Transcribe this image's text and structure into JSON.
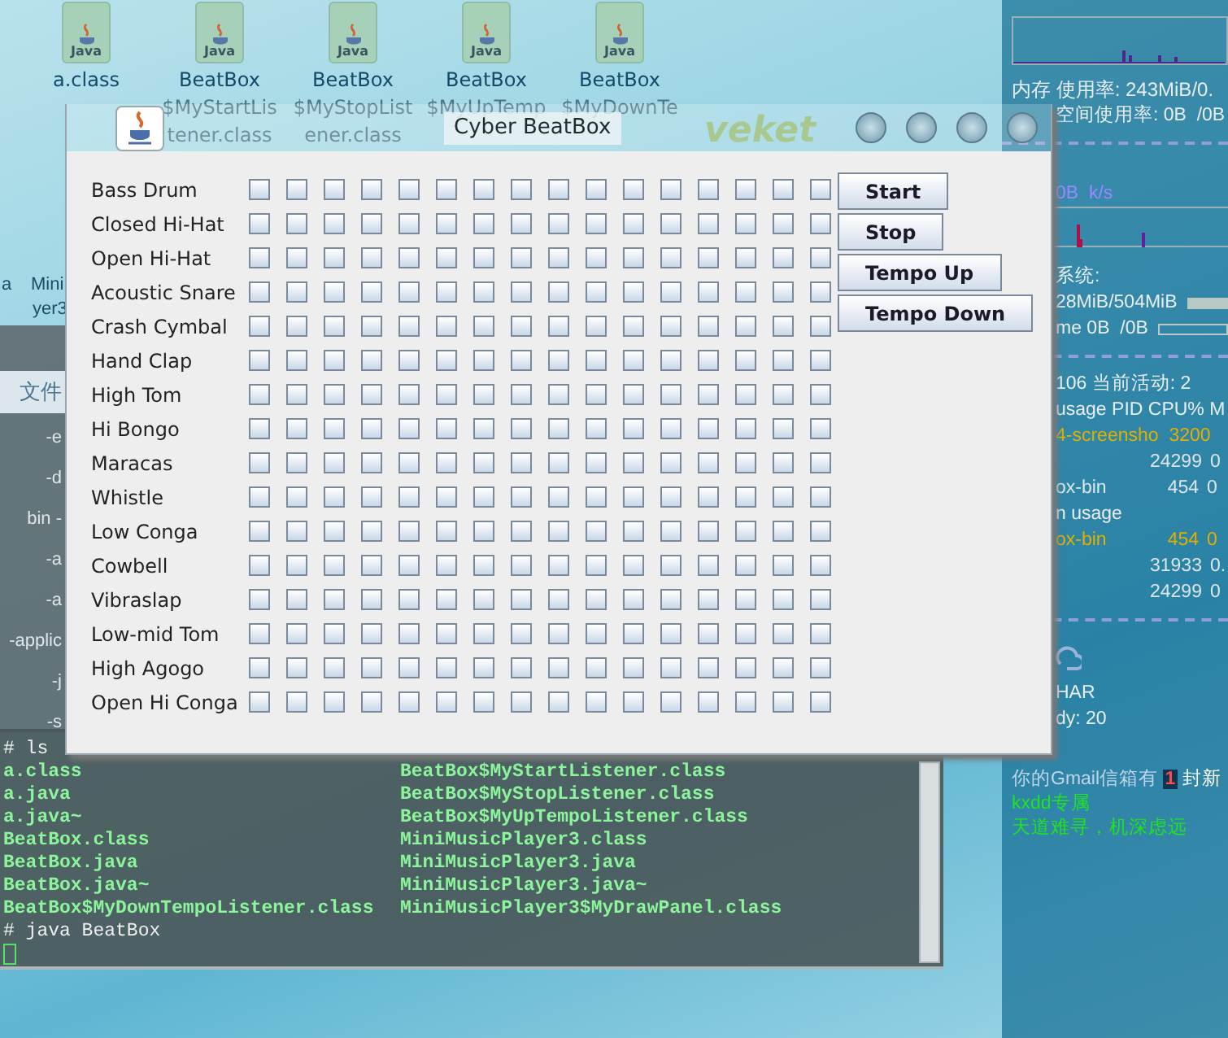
{
  "desktop_icons": [
    {
      "badge": "Java",
      "lines": [
        "a.class"
      ]
    },
    {
      "badge": "Java",
      "lines": [
        "BeatBox",
        "$MyStartLis",
        "tener.class"
      ]
    },
    {
      "badge": "Java",
      "lines": [
        "BeatBox",
        "$MyStopList",
        "ener.class"
      ]
    },
    {
      "badge": "Java",
      "lines": [
        "BeatBox",
        "$MyUpTemp"
      ]
    },
    {
      "badge": "Java",
      "lines": [
        "BeatBox",
        "$MyDownTe"
      ]
    }
  ],
  "back_window": {
    "labels": [
      "a",
      "Mini",
      "yer3"
    ],
    "menu": "文件",
    "options": [
      "-e",
      "-d",
      "bin -",
      "-a",
      "-a",
      "-applic",
      "-j",
      "-s"
    ]
  },
  "terminal": {
    "lines": [
      {
        "kind": "command",
        "text": "# ls"
      },
      {
        "kind": "listing",
        "columns": [
          "a.class",
          "BeatBox$MyStartListener.class"
        ]
      },
      {
        "kind": "listing",
        "columns": [
          "a.java",
          "BeatBox$MyStopListener.class"
        ]
      },
      {
        "kind": "listing",
        "columns": [
          "a.java~",
          "BeatBox$MyUpTempoListener.class"
        ]
      },
      {
        "kind": "listing",
        "columns": [
          "BeatBox.class",
          "MiniMusicPlayer3.class"
        ]
      },
      {
        "kind": "listing",
        "columns": [
          "BeatBox.java",
          "MiniMusicPlayer3.java"
        ]
      },
      {
        "kind": "listing",
        "columns": [
          "BeatBox.java~",
          "MiniMusicPlayer3.java~"
        ]
      },
      {
        "kind": "listing",
        "columns": [
          "BeatBox$MyDownTempoListener.class",
          "MiniMusicPlayer3$MyDrawPanel.class"
        ]
      },
      {
        "kind": "command",
        "text": "# java BeatBox"
      },
      {
        "kind": "cursor"
      }
    ]
  },
  "conky": {
    "top": [
      {
        "kind": "graph"
      },
      {
        "kind": "text",
        "text": "内存 使用率: 243MiB/0."
      }
    ],
    "middle": [
      {
        "kind": "text",
        "text": "空间使用率: 0B  /0B"
      },
      {
        "kind": "dashes"
      },
      {
        "kind": "rate",
        "text": "0B  k/s"
      },
      {
        "kind": "graph"
      },
      {
        "kind": "text",
        "text": "系统:"
      },
      {
        "kind": "bar",
        "text": "28MiB/504MiB",
        "level": 1
      },
      {
        "kind": "bar",
        "text": "me 0B  /0B",
        "level": 0
      },
      {
        "kind": "dashes"
      },
      {
        "kind": "text",
        "text": "106 当前活动: 2"
      },
      {
        "kind": "text",
        "text": "usage PID CPU% M"
      },
      {
        "kind": "process",
        "name": "4-screensho",
        "pid": "3200",
        "highlight": true
      },
      {
        "kind": "process",
        "pid": "24299",
        "cpu": "0",
        "highlight": false
      },
      {
        "kind": "process",
        "name": "ox-bin",
        "pid": "454",
        "cpu": "0",
        "highlight": false
      },
      {
        "kind": "text",
        "text": "n usage"
      },
      {
        "kind": "process",
        "name": "ox-bin",
        "pid": "454",
        "cpu": "0",
        "highlight": true
      },
      {
        "kind": "process",
        "pid": "31933",
        "cpu": "0.",
        "highlight": false
      },
      {
        "kind": "process",
        "pid": "24299",
        "cpu": "0",
        "highlight": false
      },
      {
        "kind": "dashes"
      },
      {
        "kind": "weather"
      },
      {
        "kind": "text",
        "text": "HAR"
      },
      {
        "kind": "text",
        "text": "dy: 20"
      }
    ],
    "mail": {
      "before": "你的Gmail信箱有",
      "count": "1",
      "after": "封新"
    },
    "notes": [
      "kxdd专属",
      "天道难寻，机深虑远"
    ]
  },
  "window": {
    "title": "Cyber BeatBox",
    "logo_text": "veket",
    "instruments": [
      {
        "name": "Bass Drum",
        "steps": [
          false,
          false,
          false,
          false,
          false,
          false,
          false,
          false,
          false,
          false,
          false,
          false,
          false,
          false,
          false,
          false
        ]
      },
      {
        "name": "Closed Hi-Hat",
        "steps": [
          false,
          false,
          false,
          false,
          false,
          false,
          false,
          false,
          false,
          false,
          false,
          false,
          false,
          false,
          false,
          false
        ]
      },
      {
        "name": "Open Hi-Hat",
        "steps": [
          false,
          false,
          false,
          false,
          false,
          false,
          false,
          false,
          false,
          false,
          false,
          false,
          false,
          false,
          false,
          false
        ]
      },
      {
        "name": "Acoustic Snare",
        "steps": [
          false,
          false,
          false,
          false,
          false,
          false,
          false,
          false,
          false,
          false,
          false,
          false,
          false,
          false,
          false,
          false
        ]
      },
      {
        "name": "Crash Cymbal",
        "steps": [
          false,
          false,
          false,
          false,
          false,
          false,
          false,
          false,
          false,
          false,
          false,
          false,
          false,
          false,
          false,
          false
        ]
      },
      {
        "name": "Hand Clap",
        "steps": [
          false,
          false,
          false,
          false,
          false,
          false,
          false,
          false,
          false,
          false,
          false,
          false,
          false,
          false,
          false,
          false
        ]
      },
      {
        "name": "High Tom",
        "steps": [
          false,
          false,
          false,
          false,
          false,
          false,
          false,
          false,
          false,
          false,
          false,
          false,
          false,
          false,
          false,
          false
        ]
      },
      {
        "name": "Hi Bongo",
        "steps": [
          false,
          false,
          false,
          false,
          false,
          false,
          false,
          false,
          false,
          false,
          false,
          false,
          false,
          false,
          false,
          false
        ]
      },
      {
        "name": "Maracas",
        "steps": [
          false,
          false,
          false,
          false,
          false,
          false,
          false,
          false,
          false,
          false,
          false,
          false,
          false,
          false,
          false,
          false
        ]
      },
      {
        "name": "Whistle",
        "steps": [
          false,
          false,
          false,
          false,
          false,
          false,
          false,
          false,
          false,
          false,
          false,
          false,
          false,
          false,
          false,
          false
        ]
      },
      {
        "name": "Low Conga",
        "steps": [
          false,
          false,
          false,
          false,
          false,
          false,
          false,
          false,
          false,
          false,
          false,
          false,
          false,
          false,
          false,
          false
        ]
      },
      {
        "name": "Cowbell",
        "steps": [
          false,
          false,
          false,
          false,
          false,
          false,
          false,
          false,
          false,
          false,
          false,
          false,
          false,
          false,
          false,
          false
        ]
      },
      {
        "name": "Vibraslap",
        "steps": [
          false,
          false,
          false,
          false,
          false,
          false,
          false,
          false,
          false,
          false,
          false,
          false,
          false,
          false,
          false,
          false
        ]
      },
      {
        "name": "Low-mid Tom",
        "steps": [
          false,
          false,
          false,
          false,
          false,
          false,
          false,
          false,
          false,
          false,
          false,
          false,
          false,
          false,
          false,
          false
        ]
      },
      {
        "name": "High Agogo",
        "steps": [
          false,
          false,
          false,
          false,
          false,
          false,
          false,
          false,
          false,
          false,
          false,
          false,
          false,
          false,
          false,
          false
        ]
      },
      {
        "name": "Open Hi Conga",
        "steps": [
          false,
          false,
          false,
          false,
          false,
          false,
          false,
          false,
          false,
          false,
          false,
          false,
          false,
          false,
          false,
          false
        ]
      }
    ],
    "buttons": [
      "Start",
      "Stop",
      "Tempo Up",
      "Tempo Down"
    ]
  }
}
